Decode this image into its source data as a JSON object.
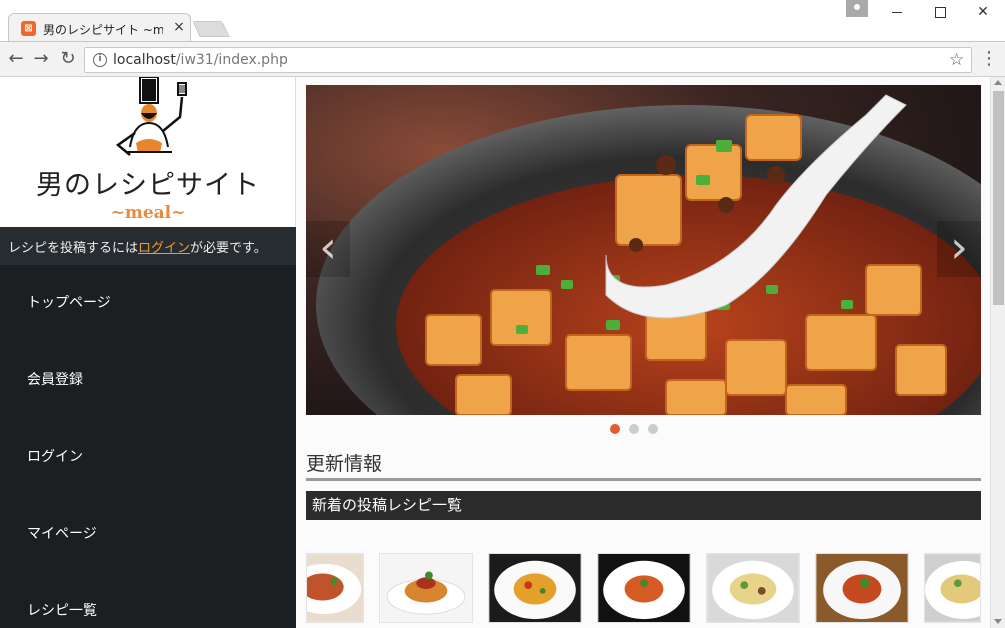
{
  "browser": {
    "tab": {
      "favicon": "xampp-icon",
      "title": "男のレシピサイト ~meal~ ト",
      "close_glyph": "×"
    },
    "address_bar": {
      "host": "localhost",
      "path": "/iw31/index.php"
    },
    "icons": {
      "back": "←",
      "forward": "→",
      "reload": "↻",
      "info": "i",
      "star": "☆",
      "menu": "⋮"
    }
  },
  "site": {
    "logo": {
      "title": "男のレシピサイト",
      "subtitle": "~meal~"
    },
    "login_notice": {
      "before": "レシピを投稿するには",
      "link": "ログイン",
      "after": "が必要です。"
    },
    "nav": [
      {
        "label": "トップページ"
      },
      {
        "label": "会員登録"
      },
      {
        "label": "ログイン"
      },
      {
        "label": "マイページ"
      },
      {
        "label": "レシピ一覧"
      }
    ]
  },
  "carousel": {
    "prev_glyph": "‹",
    "next_glyph": "›",
    "slide_count": 3,
    "active_slide": 1
  },
  "updates": {
    "heading": "更新情報",
    "subheading": "新着の投稿レシピ一覧"
  },
  "colors": {
    "sidebar_bg": "#1c1f22",
    "accent_orange": "#e25b2c",
    "link_orange": "#f39a37",
    "logo_sub": "#e68a3c",
    "subbar_bg": "#2b2b2b"
  }
}
